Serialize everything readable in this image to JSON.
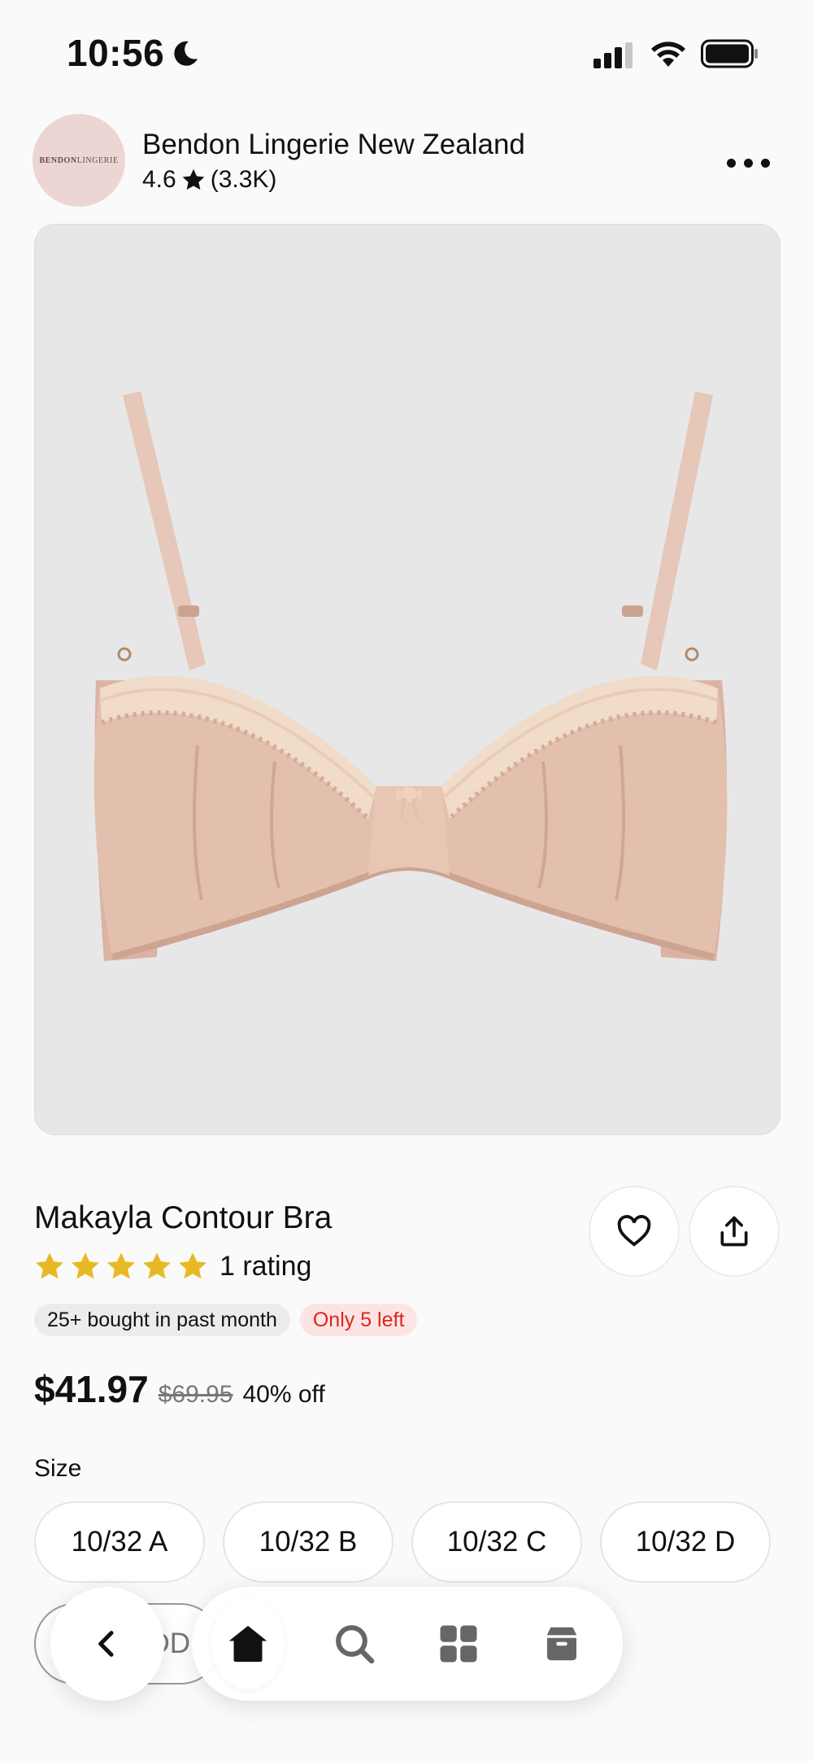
{
  "status_bar": {
    "time": "10:56"
  },
  "store": {
    "logo_text_bold": "BENDON",
    "logo_text_light": "LINGERIE",
    "name": "Bendon Lingerie New Zealand",
    "rating": "4.6",
    "review_count": "(3.3K)"
  },
  "product": {
    "title": "Makayla Contour Bra",
    "stars": 5,
    "rating_text": "1 rating",
    "badges": {
      "bought": "25+ bought in past month",
      "stock": "Only 5 left"
    },
    "price": {
      "current": "$41.97",
      "original": "$69.95",
      "discount": "40% off"
    }
  },
  "size": {
    "label": "Size",
    "options": [
      "10/32 A",
      "10/32 B",
      "10/32 C",
      "10/32 D"
    ],
    "partial_option": "DD"
  },
  "nav": {
    "items": [
      "home-icon",
      "search-icon",
      "categories-icon",
      "orders-icon"
    ]
  },
  "colors": {
    "star": "#e8b923",
    "stock_red": "#d9281e",
    "stock_bg": "#fde4e4",
    "image_bg": "#e7e7e8",
    "bra": "#e3bfae"
  }
}
